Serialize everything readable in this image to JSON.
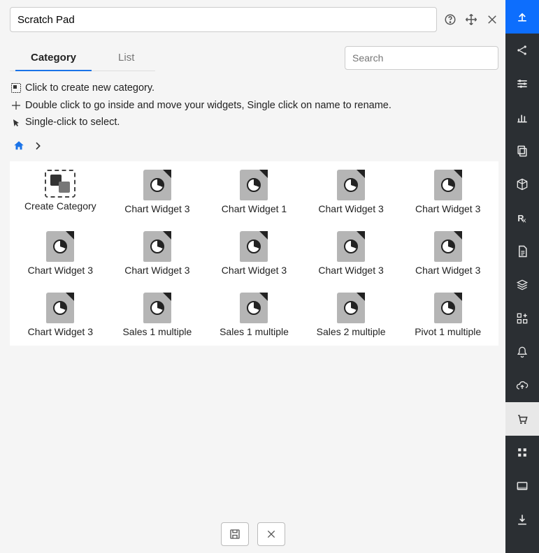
{
  "title": "Scratch Pad",
  "tabs": {
    "category": "Category",
    "list": "List",
    "active": "category"
  },
  "search": {
    "placeholder": "Search"
  },
  "hints": [
    "Click to create new category.",
    "Double click to go inside and move your widgets, Single click on name to rename.",
    "Single-click to select."
  ],
  "grid": {
    "items": [
      {
        "label": "Create Category",
        "type": "create"
      },
      {
        "label": "Chart Widget 3",
        "type": "file"
      },
      {
        "label": "Chart Widget 1",
        "type": "file"
      },
      {
        "label": "Chart Widget 3",
        "type": "file"
      },
      {
        "label": "Chart Widget 3",
        "type": "file"
      },
      {
        "label": "Chart Widget 3",
        "type": "file"
      },
      {
        "label": "Chart Widget 3",
        "type": "file"
      },
      {
        "label": "Chart Widget 3",
        "type": "file"
      },
      {
        "label": "Chart Widget 3",
        "type": "file"
      },
      {
        "label": "Chart Widget 3",
        "type": "file"
      },
      {
        "label": "Chart Widget 3",
        "type": "file"
      },
      {
        "label": "Sales 1 multiple",
        "type": "file"
      },
      {
        "label": "Sales 1 multiple",
        "type": "file"
      },
      {
        "label": "Sales 2 multiple",
        "type": "file"
      },
      {
        "label": "Pivot 1 multiple",
        "type": "file"
      }
    ]
  },
  "sidebar": {
    "items": [
      {
        "name": "upload-icon",
        "accent": true
      },
      {
        "name": "share-icon"
      },
      {
        "name": "sliders-icon"
      },
      {
        "name": "bar-chart-icon"
      },
      {
        "name": "copy-icon"
      },
      {
        "name": "cube-icon"
      },
      {
        "name": "rx-icon"
      },
      {
        "name": "document-icon"
      },
      {
        "name": "layers-icon"
      },
      {
        "name": "apps-add-icon"
      },
      {
        "name": "bell-icon"
      },
      {
        "name": "cloud-upload-icon"
      },
      {
        "name": "cart-icon",
        "active": true
      },
      {
        "name": "grid-icon"
      },
      {
        "name": "panel-icon"
      },
      {
        "name": "download-icon"
      }
    ]
  }
}
